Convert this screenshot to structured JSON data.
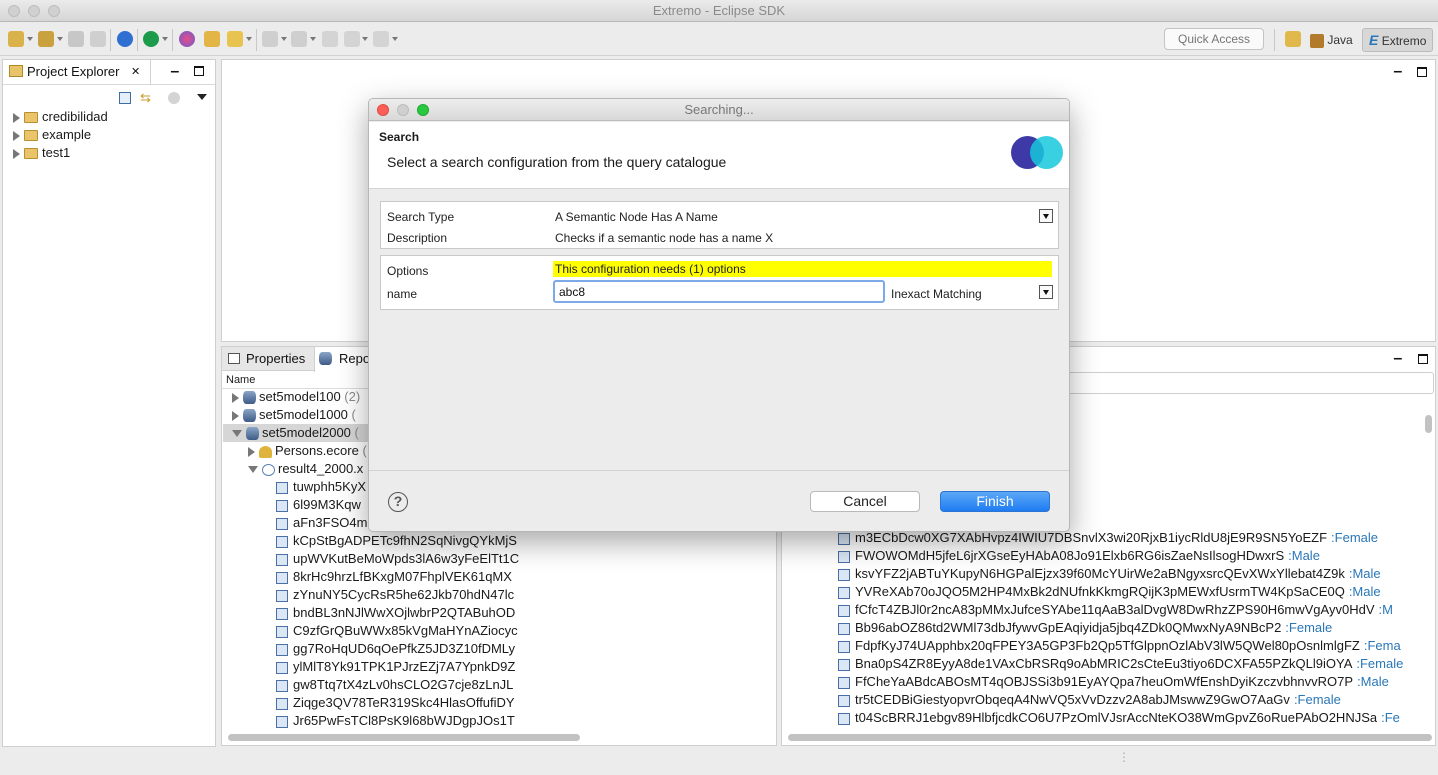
{
  "window": {
    "title": "Extremo - Eclipse SDK"
  },
  "toolbar": {
    "quick_access_placeholder": "Quick Access",
    "perspectives": [
      {
        "label": "Java"
      },
      {
        "label": "Extremo",
        "icon_letter": "E"
      }
    ]
  },
  "project_explorer": {
    "tab_label": "Project Explorer",
    "close_symbol": "✕",
    "items": [
      {
        "label": "credibilidad"
      },
      {
        "label": "example"
      },
      {
        "label": "test1"
      }
    ]
  },
  "bottom_left": {
    "tabs": [
      {
        "label": "Properties"
      },
      {
        "label": "Repo"
      }
    ],
    "column_header": "Name",
    "repos": [
      {
        "label": "set5model100",
        "count": "(2)"
      },
      {
        "label": "set5model1000",
        "count": "("
      },
      {
        "label": "set5model2000",
        "count": "("
      }
    ],
    "children": [
      {
        "label": "Persons.ecore",
        "suffix": "("
      },
      {
        "label": "result4_2000.x"
      }
    ],
    "objects": [
      "tuwphh5KyX",
      "6l99M3Kqw",
      "aFn3FSO4m",
      "kCpStBgADPETc9fhN2SqNivgQYkMjS",
      "upWVKutBeMoWpds3lA6w3yFeElTt1C",
      "8krHc9hrzLfBKxgM07FhplVEK61qMX",
      "zYnuNY5CycRsR5he62Jkb70hdN47lc",
      "bndBL3nNJlWwXOjlwbrP2QTABuhOD",
      "C9zfGrQBuWWx85kVgMaHYnAZiocyc",
      "gg7RoHqUD6qOePfkZ5JD3Z10fDMLy",
      "ylMlT8Yk91TPK1PJrzEZj7A7YpnkD9Z",
      "gw8Ttq7tX4zLv0hsCLO2G7cje8zLnJL",
      "Ziqge3QV78TeR319Skc4HlasOffufiDY",
      "Jr65PwFsTCl8PsK9l68bWJDgpJOs1T"
    ]
  },
  "bottom_right": {
    "results": [
      {
        "id": "m3ECbDcw0XG7XAbHvpz4IWIU7DBSnvlX3wi20RjxB1iycRldU8jE9R9SN5YoEZF",
        "gender": ":Female"
      },
      {
        "id": "FWOWOMdH5jfeL6jrXGseEyHAbA08Jo91Elxb6RG6isZaeNsIlsogHDwxrS",
        "gender": ":Male"
      },
      {
        "id": "ksvYFZ2jABTuYKupyN6HGPalEjzx39f60McYUirWe2aBNgyxsrcQEvXWxYllebat4Z9k",
        "gender": ":Male"
      },
      {
        "id": "YVReXAb70oJQO5M2HP4MxBk2dNUfnkKkmgRQijK3pMEWxfUsrmTW4KpSaCE0Q",
        "gender": ":Male"
      },
      {
        "id": "fCfcT4ZBJl0r2ncA83pMMxJufceSYAbe11qAaB3alDvgW8DwRhzZPS90H6mwVgAyv0HdV",
        "gender": ":M"
      },
      {
        "id": "Bb96abOZ86td2WMl73dbJfywvGpEAqiyidja5jbq4ZDk0QMwxNyA9NBcP2",
        "gender": ":Female"
      },
      {
        "id": "FdpfKyJ74UApphbx20qFPEY3A5GP3Fb2Qp5TfGlppnOzlAbV3lW5QWel80pOsnlmlgFZ",
        "gender": ":Fema"
      },
      {
        "id": "Bna0pS4ZR8EyyA8de1VAxCbRSRq9oAbMRIC2sCteEu3tiyo6DCXFA55PZkQLl9iOYA",
        "gender": ":Female"
      },
      {
        "id": "FfCheYaABdcABOsMT4qOBJSSi3b91EyAYQpa7heuOmWfEnshDyiKzczvbhnvvRO7P",
        "gender": ":Male"
      },
      {
        "id": "tr5tCEDBiGiestyopvrObqeqA4NwVQ5xVvDzzv2A8abJMswwZ9GwO7AaGv",
        "gender": ":Female"
      },
      {
        "id": "t04ScBRRJ1ebgv89HlbfjcdkCO6U7PzOmlVJsrAccNteKO38WmGpvZ6oRuePAbO2HNJSa",
        "gender": ":Fe"
      }
    ]
  },
  "dialog": {
    "title": "Searching...",
    "heading": "Search",
    "subtitle": "Select a search configuration from the query catalogue",
    "search_type_label": "Search Type",
    "search_type_value": "A Semantic Node Has A Name",
    "description_label": "Description",
    "description_value": "Checks if a semantic node has a name X",
    "options_label": "Options",
    "options_notice": "This configuration needs (1) options",
    "name_label": "name",
    "name_value": "abc8",
    "matching_value": "Inexact Matching",
    "help_symbol": "?",
    "cancel_label": "Cancel",
    "finish_label": "Finish"
  },
  "colors": {
    "accent": "#1f7cf2",
    "notice_bg": "#ffff00",
    "gender_link": "#2a77b8"
  }
}
